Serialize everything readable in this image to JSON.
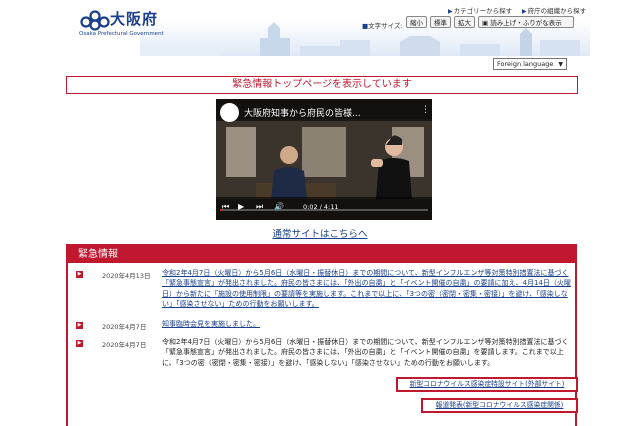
{
  "header": {
    "logo_text": "大阪府",
    "logo_sub": "Osaka Prefectural Government",
    "top_links": [
      {
        "label": "カテゴリーから探す"
      },
      {
        "label": "府庁の組織から探す"
      }
    ],
    "font_size_label": "文字サイズ",
    "font_size_buttons": [
      "縮小",
      "標準",
      "拡大"
    ],
    "read_aloud_label": "読み上げ・ふりがな表示",
    "foreign_language": "Foreign language"
  },
  "emergency_banner": "緊急情報トップページを表示しています",
  "video": {
    "title": "大阪府知事から府民の皆様...",
    "time": "0:02 / 4:11",
    "progress": 0.01
  },
  "normal_site_link": "通常サイトはこちらへ",
  "emergency": {
    "heading": "緊急情報",
    "items": [
      {
        "date": "2020年4月13日",
        "text": "令和2年4月7日（火曜日）から5月6日（水曜日・振替休日）までの期間について、新型インフルエンザ等対策特別措置法に基づく「緊急事態宣言」が発出されました。府民の皆さまには、「外出の自粛」と「イベント開催の自粛」の要請に加え、4月14日（火曜日）から新たに「施設の使用制限」の要請等を実施します。これまで以上に、「3つの密（密閉・密集・密接）」を避け、「感染しない」「感染させない」ための行動をお願いします。",
        "is_link": true
      },
      {
        "date": "2020年4月7日",
        "text": "知事臨時会見を実施しました。",
        "is_link": true
      },
      {
        "date": "2020年4月7日",
        "text": "令和2年4月7日（火曜日）から5月6日（水曜日・振替休日）までの期間について、新型インフルエンザ等対策特別措置法に基づく「緊急事態宣言」が発出されました。府民の皆さまには、「外出の自粛」と「イベント開催の自粛」を要請します。これまで以上に、「3つの密（密閉・密集・密接）」を避け、「感染しない」「感染させない」ための行動をお願いします。",
        "is_link": false
      }
    ],
    "special_site_link": "新型コロナウイルス感染症特設サイト(外部サイト)",
    "press_link": "報道発表(新型コロナウイルス感染症関係)"
  },
  "colors": {
    "accent_red": "#c0182f",
    "link_blue": "#1a3f8c"
  }
}
